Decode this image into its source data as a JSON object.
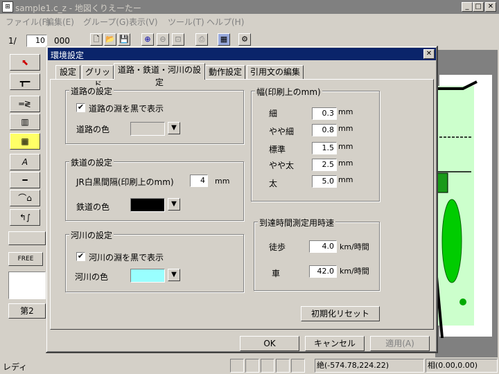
{
  "app": {
    "title": "sample1.c_z - 地図くりえーたー",
    "menu": [
      "ファイル(F)",
      "編集(E)",
      "グループ(G)",
      "表示(V)",
      "ツール(T)",
      "ヘルプ(H)"
    ],
    "page_prefix": "1/",
    "page_value": "10",
    "page_suffix": "000",
    "free_label": "FREE",
    "side_button_label": "第2",
    "status_text": "レディ",
    "status_abs": "絶(-574.78,224.22)",
    "status_rel": "相(0.00,0.00)"
  },
  "dialog": {
    "title": "環境設定",
    "tabs": [
      "設定",
      "グリッド",
      "道路・鉄道・河川の設定",
      "動作設定",
      "引用文の編集"
    ],
    "active_tab": 2,
    "road": {
      "legend": "道路の設定",
      "edge_checkbox": "道路の淵を黒で表示",
      "edge_checked": "✔",
      "color_label": "道路の色",
      "color": "#d4d0c8"
    },
    "rail": {
      "legend": "鉄道の設定",
      "jr_label": "JR白黒間隔(印刷上のmm)",
      "jr_value": "4",
      "jr_unit": "mm",
      "color_label": "鉄道の色",
      "color": "#000000"
    },
    "river": {
      "legend": "河川の設定",
      "edge_checkbox": "河川の淵を黒で表示",
      "edge_checked": "✔",
      "color_label": "河川の色",
      "color": "#99ffff"
    },
    "width": {
      "legend": "幅(印刷上のmm)",
      "rows": [
        {
          "label": "細",
          "value": "0.3",
          "unit": "mm"
        },
        {
          "label": "やや細",
          "value": "0.8",
          "unit": "mm"
        },
        {
          "label": "標準",
          "value": "1.5",
          "unit": "mm"
        },
        {
          "label": "やや太",
          "value": "2.5",
          "unit": "mm"
        },
        {
          "label": "太",
          "value": "5.0",
          "unit": "mm"
        }
      ]
    },
    "speed": {
      "legend": "到達時間測定用時速",
      "walk_label": "徒歩",
      "walk_value": "4.0",
      "walk_unit": "km/時間",
      "car_label": "車",
      "car_value": "42.0",
      "car_unit": "km/時間"
    },
    "reset_button": "初期化リセット",
    "ok_button": "OK",
    "cancel_button": "キャンセル",
    "apply_button": "適用(A)"
  }
}
